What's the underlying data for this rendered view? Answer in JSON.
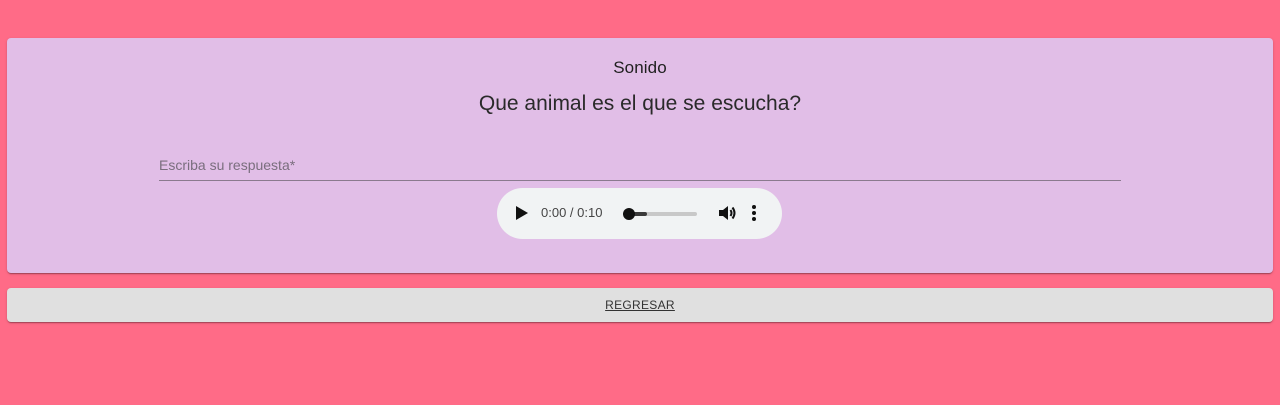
{
  "card": {
    "title": "Sonido",
    "question": "Que animal es el que se escucha?"
  },
  "answer_field": {
    "placeholder": "Escriba su respuesta*",
    "value": ""
  },
  "audio_player": {
    "time": "0:00 / 0:10",
    "progress": 0.0,
    "play_icon": "play-icon",
    "volume_icon": "volume-icon",
    "more_icon": "more-vertical-icon"
  },
  "back_button": {
    "label": "REGRESAR"
  },
  "colors": {
    "background": "#ff6b87",
    "card": "#e1bee7",
    "button": "#e0e0e0",
    "player": "#f1f3f4"
  }
}
